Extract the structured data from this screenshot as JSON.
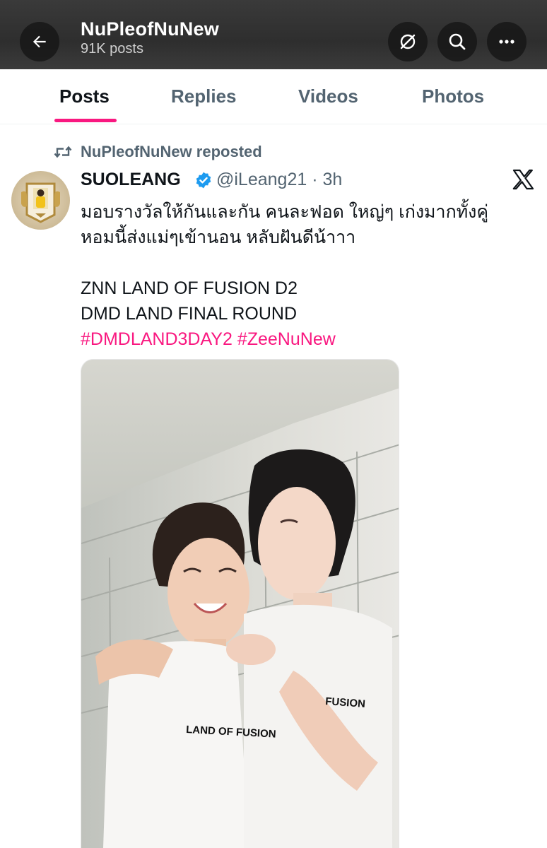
{
  "header": {
    "title": "NuPleofNuNew",
    "subtitle": "91K posts",
    "icons": [
      "back-arrow-icon",
      "grok-icon",
      "search-icon",
      "more-icon"
    ],
    "background": "#333333"
  },
  "tabs": [
    {
      "label": "Posts",
      "active": true
    },
    {
      "label": "Replies",
      "active": false
    },
    {
      "label": "Videos",
      "active": false
    },
    {
      "label": "Photos",
      "active": false
    }
  ],
  "accent_color": "#f91880",
  "post": {
    "repost_label": "NuPleofNuNew reposted",
    "author_name": "SUOLEANG",
    "verified": true,
    "handle_time": "@iLeang21 · 3h",
    "text_lines": [
      "มอบรางวัลให้กันและกัน คนละฟอด ใหญ่ๆ เก่งมากทั้งคู่",
      "หอมนี้ส่งแม่ๆเข้านอน หลับฝันดีน้าาา",
      "ZNN LAND OF FUSION D2",
      "DMD LAND FINAL ROUND"
    ],
    "hashtags": "#DMDLAND3DAY2 #ZeeNuNew",
    "media": {
      "shirt_text_left": "LAND OF FUSION",
      "shirt_text_right": "FUSION"
    }
  }
}
